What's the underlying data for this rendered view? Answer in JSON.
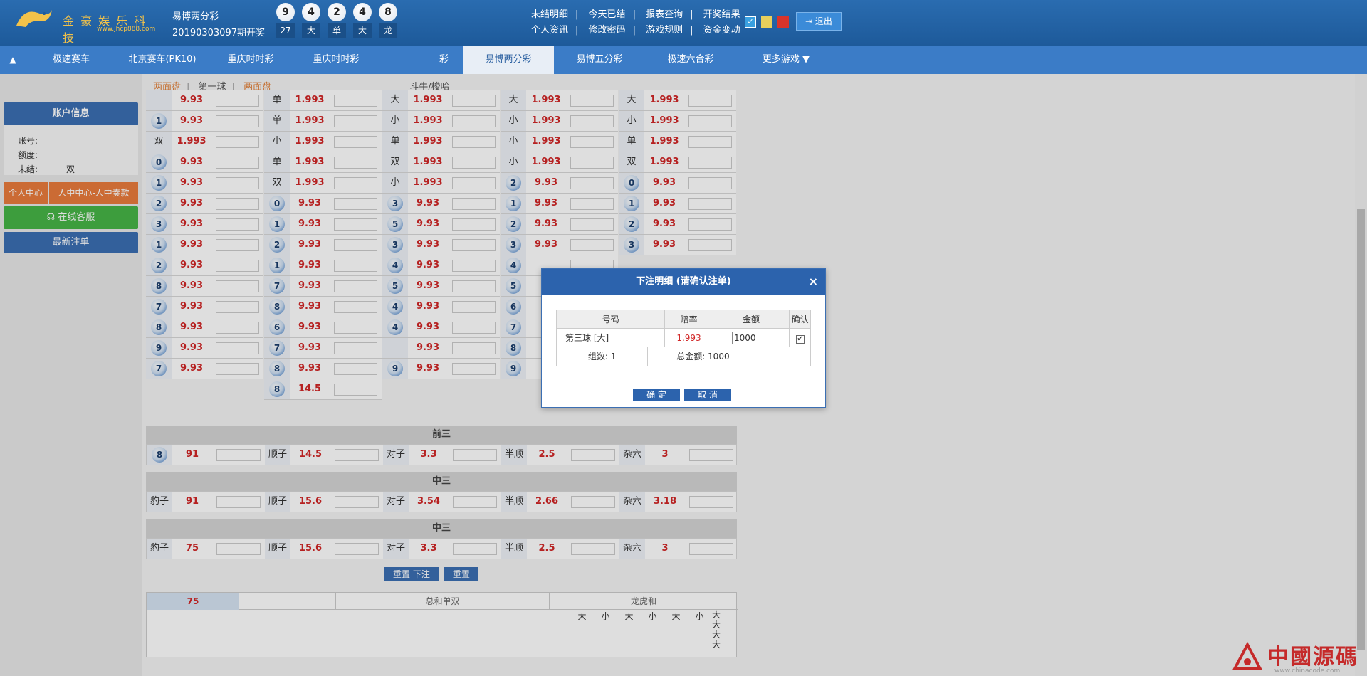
{
  "header": {
    "logo_text": "金 豪 娱 乐 科 技",
    "logo_url": "www.jhcp888.com",
    "game_name": "易博两分彩",
    "period": "20190303097期开奖",
    "balls": [
      "9",
      "4",
      "2",
      "4",
      "8"
    ],
    "summary": [
      "27",
      "大",
      "单",
      "大",
      "龙"
    ],
    "links_row1": [
      "未结明细",
      "今天已结",
      "报表查询",
      "开奖结果"
    ],
    "links_row2": [
      "个人资讯",
      "修改密码",
      "游戏规则",
      "资金变动"
    ],
    "swatch_colors": [
      "#3aa0e0",
      "#e7cf5c",
      "#d9342b"
    ],
    "logout": "退出"
  },
  "nav": {
    "items": [
      "极速赛车",
      "北京赛车(PK10)",
      "重庆时时彩",
      "重庆时时彩",
      "彩",
      "易博两分彩",
      "易博五分彩",
      "极速六合彩",
      "更多游戏 ▼"
    ],
    "active_index": 5
  },
  "subtabs": {
    "items": [
      "两面盘",
      "第一球",
      "两面盘",
      "斗牛/梭哈"
    ],
    "hot_indices": [
      0,
      2
    ]
  },
  "sidebar": {
    "account_title": "账户信息",
    "account_lines": [
      "账号:",
      "额度:",
      "未结:"
    ],
    "account_extra": "双",
    "btn_personal": "个人中心",
    "btn_personal2": "人中中心-人中奏款",
    "btn_service": "在线客服",
    "btn_latest": "最新注单"
  },
  "grid": {
    "col1": [
      {
        "lab": "",
        "odd": "9.93"
      },
      {
        "lab": "1",
        "ball": true,
        "odd": "9.93"
      },
      {
        "lab": "双",
        "odd": "1.993"
      },
      {
        "lab": "0",
        "ball": true,
        "odd": "9.93"
      },
      {
        "lab": "1",
        "ball": true,
        "odd": "9.93"
      },
      {
        "lab": "2",
        "ball": true,
        "odd": "9.93"
      },
      {
        "lab": "3",
        "ball": true,
        "odd": "9.93"
      },
      {
        "lab": "1",
        "ball": true,
        "odd": "9.93"
      },
      {
        "lab": "2",
        "ball": true,
        "odd": "9.93"
      },
      {
        "lab": "8",
        "ball": true,
        "odd": "9.93"
      },
      {
        "lab": "7",
        "ball": true,
        "odd": "9.93"
      },
      {
        "lab": "8",
        "ball": true,
        "odd": "9.93"
      },
      {
        "lab": "9",
        "ball": true,
        "odd": "9.93"
      },
      {
        "lab": "7",
        "ball": true,
        "odd": "9.93"
      }
    ],
    "col2": [
      {
        "lab": "单",
        "odd": "1.993"
      },
      {
        "lab": "单",
        "odd": "1.993"
      },
      {
        "lab": "小",
        "odd": "1.993"
      },
      {
        "lab": "单",
        "odd": "1.993"
      },
      {
        "lab": "双",
        "odd": "1.993"
      },
      {
        "lab": "0",
        "ball": true,
        "odd": "9.93"
      },
      {
        "lab": "1",
        "ball": true,
        "odd": "9.93"
      },
      {
        "lab": "2",
        "ball": true,
        "odd": "9.93"
      },
      {
        "lab": "1",
        "ball": true,
        "odd": "9.93"
      },
      {
        "lab": "7",
        "ball": true,
        "odd": "9.93"
      },
      {
        "lab": "8",
        "ball": true,
        "odd": "9.93"
      },
      {
        "lab": "6",
        "ball": true,
        "odd": "9.93"
      },
      {
        "lab": "7",
        "ball": true,
        "odd": "9.93"
      },
      {
        "lab": "8",
        "ball": true,
        "odd": "9.93"
      },
      {
        "lab": "8",
        "ball": true,
        "odd": "14.5"
      }
    ],
    "col3": [
      {
        "lab": "大",
        "odd": "1.993"
      },
      {
        "lab": "小",
        "odd": "1.993"
      },
      {
        "lab": "单",
        "odd": "1.993"
      },
      {
        "lab": "双",
        "odd": "1.993"
      },
      {
        "lab": "小",
        "odd": "1.993"
      },
      {
        "lab": "3",
        "ball": true,
        "odd": "9.93"
      },
      {
        "lab": "5",
        "ball": true,
        "odd": "9.93"
      },
      {
        "lab": "3",
        "ball": true,
        "odd": "9.93"
      },
      {
        "lab": "4",
        "ball": true,
        "odd": "9.93"
      },
      {
        "lab": "5",
        "ball": true,
        "odd": "9.93"
      },
      {
        "lab": "4",
        "ball": true,
        "odd": "9.93"
      },
      {
        "lab": "4",
        "ball": true,
        "odd": "9.93"
      },
      {
        "lab": "",
        "odd": "9.93"
      },
      {
        "lab": "9",
        "ball": true,
        "odd": "9.93"
      }
    ],
    "col4": [
      {
        "lab": "大",
        "odd": "1.993"
      },
      {
        "lab": "小",
        "odd": "1.993"
      },
      {
        "lab": "小",
        "odd": "1.993"
      },
      {
        "lab": "小",
        "odd": "1.993"
      },
      {
        "lab": "2",
        "ball": true,
        "odd": "9.93"
      },
      {
        "lab": "1",
        "ball": true,
        "odd": "9.93"
      },
      {
        "lab": "2",
        "ball": true,
        "odd": "9.93"
      },
      {
        "lab": "3",
        "ball": true,
        "odd": "9.93"
      },
      {
        "lab": "4",
        "ball": true,
        "odd": ""
      },
      {
        "lab": "5",
        "ball": true,
        "odd": ""
      },
      {
        "lab": "6",
        "ball": true,
        "odd": ""
      },
      {
        "lab": "7",
        "ball": true,
        "odd": ""
      },
      {
        "lab": "8",
        "ball": true,
        "odd": ""
      },
      {
        "lab": "9",
        "ball": true,
        "odd": ""
      }
    ],
    "col5": [
      {
        "lab": "大",
        "odd": "1.993"
      },
      {
        "lab": "小",
        "odd": "1.993"
      },
      {
        "lab": "单",
        "odd": "1.993"
      },
      {
        "lab": "双",
        "odd": "1.993"
      },
      {
        "lab": "0",
        "ball": true,
        "odd": "9.93"
      },
      {
        "lab": "1",
        "ball": true,
        "odd": "9.93"
      },
      {
        "lab": "2",
        "ball": true,
        "odd": "9.93"
      },
      {
        "lab": "3",
        "ball": true,
        "odd": "9.93"
      }
    ]
  },
  "sections": [
    {
      "title": "前三",
      "row": [
        [
          "8",
          "91"
        ],
        [
          "顺子",
          "14.5"
        ],
        [
          "对子",
          "3.3"
        ],
        [
          "半顺",
          "2.5"
        ],
        [
          "杂六",
          "3"
        ]
      ],
      "first_ball": true
    },
    {
      "title": "中三",
      "row": [
        [
          "豹子",
          "91"
        ],
        [
          "顺子",
          "15.6"
        ],
        [
          "对子",
          "3.54"
        ],
        [
          "半顺",
          "2.66"
        ],
        [
          "杂六",
          "3.18"
        ]
      ]
    },
    {
      "title": "中三",
      "row": [
        [
          "豹子",
          "75"
        ],
        [
          "顺子",
          "15.6"
        ],
        [
          "对子",
          "3.3"
        ],
        [
          "半顺",
          "2.5"
        ],
        [
          "杂六",
          "3"
        ]
      ]
    }
  ],
  "actions": {
    "submit": "重置 下注",
    "reset": "重置"
  },
  "bottom": {
    "lead_value": "75",
    "head_sum": "总和单双",
    "head_dragon": "龙虎和",
    "subs": [
      "大",
      "小",
      "大",
      "小",
      "大",
      "小",
      "大大大大"
    ]
  },
  "modal": {
    "title": "下注明细 (请确认注单)",
    "close": "×",
    "headers": [
      "号码",
      "赔率",
      "金额",
      "确认"
    ],
    "bet_name": "第三球 [大]",
    "bet_odds": "1.993",
    "amount": "1000",
    "checked": "✔",
    "count_label": "组数: 1",
    "total_label": "总金额: 1000",
    "confirm": "确 定",
    "cancel": "取 消"
  },
  "watermark": {
    "text": "中國源碼",
    "url": "www.chinacode.com",
    "color": "#c52a2a"
  }
}
